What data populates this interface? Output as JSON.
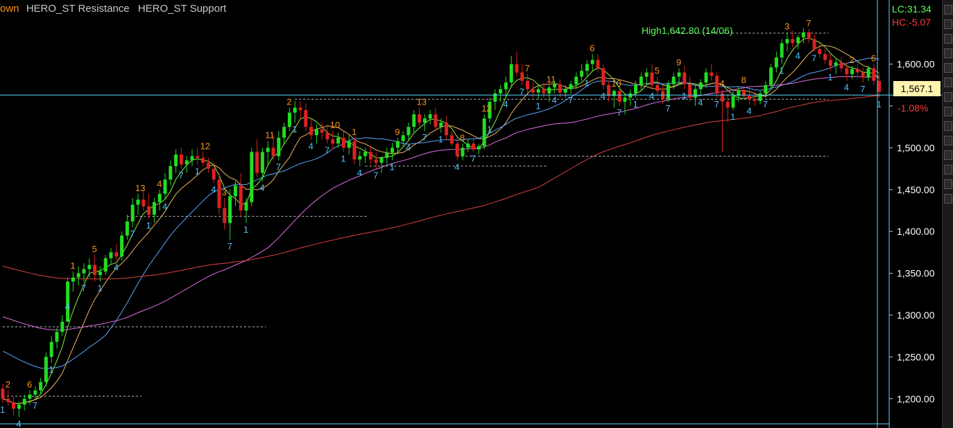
{
  "legend": {
    "cut_item": "own",
    "items": [
      "HERO_ST Resistance",
      "HERO_ST Support"
    ]
  },
  "hud": {
    "lc": "LC:31.34",
    "hc": "HC:-5.07",
    "change": "-1.08%",
    "current_price": "1,567.1"
  },
  "colors": {
    "background": "#000000",
    "up": "#22dd22",
    "down": "#dd2222",
    "cyan_line": "#5ad8ff",
    "ma_green": "#90ee40",
    "ma_orange": "#f0b860",
    "ma_blue": "#5aa8ff",
    "ma_pink": "#e070e0",
    "ma_red": "#e04040",
    "count_blue": "#4fc3f7",
    "count_orange": "#f7941d",
    "axis_text": "#ffffff"
  },
  "toolbar_icons": [
    "ruler-icon",
    "line-icon",
    "text-icon",
    "fib-icon",
    "shape-icon",
    "brush-icon",
    "measure-icon",
    "zoom-icon",
    "magnet-icon",
    "lock-icon",
    "eye-icon",
    "trash-icon",
    "settings-icon",
    "close-icon"
  ],
  "chart_data": {
    "type": "candlestick",
    "y_axis": {
      "range": [
        1170,
        1670
      ],
      "ticks": [
        1200,
        1250,
        1300,
        1350,
        1400,
        1450,
        1500,
        1550,
        1600
      ],
      "tick_labels": [
        "1,200.00",
        "1,250.00",
        "1,300.00",
        "1,350.00",
        "1,400.00",
        "1,450.00",
        "1,500.00",
        "",
        "1,600.00"
      ],
      "position": "right"
    },
    "high_annotation": "High1,642.80 (14/06)",
    "horizontal_line": 1563,
    "candles": [
      [
        1212,
        1218,
        1195,
        1200
      ],
      [
        1200,
        1210,
        1192,
        1196
      ],
      [
        1196,
        1202,
        1180,
        1188
      ],
      [
        1188,
        1197,
        1178,
        1193
      ],
      [
        1193,
        1205,
        1186,
        1200
      ],
      [
        1200,
        1210,
        1193,
        1205
      ],
      [
        1205,
        1215,
        1200,
        1210
      ],
      [
        1210,
        1225,
        1205,
        1220
      ],
      [
        1220,
        1255,
        1215,
        1250
      ],
      [
        1250,
        1275,
        1243,
        1268
      ],
      [
        1268,
        1285,
        1260,
        1280
      ],
      [
        1280,
        1300,
        1275,
        1292
      ],
      [
        1292,
        1345,
        1318,
        1340
      ],
      [
        1340,
        1352,
        1328,
        1345
      ],
      [
        1345,
        1358,
        1335,
        1350
      ],
      [
        1350,
        1362,
        1340,
        1355
      ],
      [
        1355,
        1368,
        1345,
        1360
      ],
      [
        1360,
        1372,
        1340,
        1348
      ],
      [
        1348,
        1358,
        1340,
        1352
      ],
      [
        1352,
        1372,
        1348,
        1368
      ],
      [
        1368,
        1380,
        1360,
        1375
      ],
      [
        1375,
        1385,
        1365,
        1370
      ],
      [
        1370,
        1400,
        1365,
        1395
      ],
      [
        1395,
        1420,
        1390,
        1412
      ],
      [
        1412,
        1440,
        1405,
        1432
      ],
      [
        1432,
        1445,
        1420,
        1438
      ],
      [
        1438,
        1448,
        1425,
        1430
      ],
      [
        1430,
        1445,
        1415,
        1420
      ],
      [
        1420,
        1440,
        1410,
        1435
      ],
      [
        1435,
        1450,
        1425,
        1445
      ],
      [
        1445,
        1470,
        1438,
        1462
      ],
      [
        1462,
        1485,
        1455,
        1478
      ],
      [
        1478,
        1498,
        1470,
        1492
      ],
      [
        1492,
        1500,
        1475,
        1480
      ],
      [
        1480,
        1490,
        1470,
        1485
      ],
      [
        1485,
        1498,
        1478,
        1490
      ],
      [
        1490,
        1500,
        1480,
        1488
      ],
      [
        1488,
        1495,
        1478,
        1482
      ],
      [
        1482,
        1488,
        1470,
        1475
      ],
      [
        1475,
        1482,
        1458,
        1462
      ],
      [
        1462,
        1470,
        1420,
        1428
      ],
      [
        1428,
        1440,
        1402,
        1410
      ],
      [
        1410,
        1450,
        1390,
        1442
      ],
      [
        1442,
        1460,
        1430,
        1455
      ],
      [
        1455,
        1470,
        1418,
        1425
      ],
      [
        1425,
        1440,
        1410,
        1435
      ],
      [
        1435,
        1500,
        1430,
        1495
      ],
      [
        1495,
        1510,
        1465,
        1470
      ],
      [
        1470,
        1500,
        1460,
        1495
      ],
      [
        1495,
        1508,
        1480,
        1500
      ],
      [
        1500,
        1515,
        1485,
        1490
      ],
      [
        1490,
        1520,
        1485,
        1512
      ],
      [
        1512,
        1530,
        1505,
        1525
      ],
      [
        1525,
        1548,
        1520,
        1542
      ],
      [
        1542,
        1556,
        1530,
        1548
      ],
      [
        1548,
        1555,
        1535,
        1545
      ],
      [
        1545,
        1553,
        1520,
        1525
      ],
      [
        1525,
        1535,
        1510,
        1515
      ],
      [
        1515,
        1528,
        1505,
        1522
      ],
      [
        1522,
        1530,
        1510,
        1518
      ],
      [
        1518,
        1528,
        1505,
        1510
      ],
      [
        1510,
        1520,
        1498,
        1505
      ],
      [
        1505,
        1518,
        1500,
        1512
      ],
      [
        1512,
        1520,
        1495,
        1500
      ],
      [
        1500,
        1515,
        1492,
        1508
      ],
      [
        1508,
        1512,
        1480,
        1486
      ],
      [
        1486,
        1496,
        1478,
        1490
      ],
      [
        1490,
        1500,
        1482,
        1495
      ],
      [
        1495,
        1502,
        1480,
        1486
      ],
      [
        1486,
        1494,
        1475,
        1482
      ],
      [
        1482,
        1490,
        1470,
        1488
      ],
      [
        1488,
        1500,
        1480,
        1494
      ],
      [
        1494,
        1506,
        1485,
        1500
      ],
      [
        1500,
        1512,
        1492,
        1508
      ],
      [
        1508,
        1520,
        1500,
        1515
      ],
      [
        1515,
        1530,
        1508,
        1525
      ],
      [
        1525,
        1545,
        1518,
        1540
      ],
      [
        1540,
        1548,
        1525,
        1530
      ],
      [
        1530,
        1540,
        1520,
        1535
      ],
      [
        1535,
        1545,
        1528,
        1540
      ],
      [
        1540,
        1548,
        1520,
        1525
      ],
      [
        1525,
        1535,
        1518,
        1530
      ],
      [
        1530,
        1538,
        1510,
        1515
      ],
      [
        1515,
        1520,
        1502,
        1505
      ],
      [
        1505,
        1512,
        1485,
        1490
      ],
      [
        1490,
        1505,
        1485,
        1500
      ],
      [
        1500,
        1510,
        1495,
        1505
      ],
      [
        1505,
        1512,
        1495,
        1498
      ],
      [
        1498,
        1505,
        1492,
        1502
      ],
      [
        1502,
        1540,
        1498,
        1535
      ],
      [
        1535,
        1560,
        1530,
        1555
      ],
      [
        1555,
        1570,
        1545,
        1565
      ],
      [
        1565,
        1575,
        1555,
        1570
      ],
      [
        1570,
        1585,
        1560,
        1578
      ],
      [
        1578,
        1610,
        1572,
        1600
      ],
      [
        1600,
        1615,
        1585,
        1590
      ],
      [
        1590,
        1600,
        1575,
        1580
      ],
      [
        1580,
        1588,
        1565,
        1570
      ],
      [
        1570,
        1578,
        1560,
        1566
      ],
      [
        1566,
        1575,
        1558,
        1570
      ],
      [
        1570,
        1578,
        1560,
        1565
      ],
      [
        1565,
        1575,
        1555,
        1572
      ],
      [
        1572,
        1580,
        1565,
        1576
      ],
      [
        1576,
        1582,
        1560,
        1566
      ],
      [
        1566,
        1575,
        1560,
        1570
      ],
      [
        1570,
        1580,
        1565,
        1576
      ],
      [
        1576,
        1590,
        1570,
        1585
      ],
      [
        1585,
        1600,
        1580,
        1592
      ],
      [
        1592,
        1605,
        1585,
        1600
      ],
      [
        1600,
        1612,
        1592,
        1605
      ],
      [
        1605,
        1612,
        1590,
        1595
      ],
      [
        1595,
        1600,
        1570,
        1575
      ],
      [
        1575,
        1580,
        1555,
        1562
      ],
      [
        1562,
        1570,
        1548,
        1568
      ],
      [
        1568,
        1575,
        1550,
        1555
      ],
      [
        1555,
        1565,
        1540,
        1560
      ],
      [
        1560,
        1570,
        1550,
        1565
      ],
      [
        1565,
        1580,
        1560,
        1575
      ],
      [
        1575,
        1590,
        1568,
        1585
      ],
      [
        1585,
        1595,
        1575,
        1590
      ],
      [
        1590,
        1600,
        1570,
        1575
      ],
      [
        1575,
        1585,
        1562,
        1568
      ],
      [
        1568,
        1575,
        1552,
        1558
      ],
      [
        1558,
        1580,
        1555,
        1576
      ],
      [
        1576,
        1590,
        1570,
        1585
      ],
      [
        1585,
        1595,
        1575,
        1590
      ],
      [
        1590,
        1598,
        1570,
        1576
      ],
      [
        1576,
        1585,
        1555,
        1560
      ],
      [
        1560,
        1575,
        1550,
        1570
      ],
      [
        1570,
        1582,
        1562,
        1578
      ],
      [
        1578,
        1595,
        1572,
        1590
      ],
      [
        1590,
        1600,
        1580,
        1586
      ],
      [
        1586,
        1590,
        1560,
        1565
      ],
      [
        1565,
        1570,
        1495,
        1555
      ],
      [
        1555,
        1565,
        1530,
        1548
      ],
      [
        1548,
        1568,
        1545,
        1562
      ],
      [
        1562,
        1572,
        1555,
        1568
      ],
      [
        1568,
        1574,
        1558,
        1562
      ],
      [
        1562,
        1570,
        1552,
        1558
      ],
      [
        1558,
        1565,
        1550,
        1556
      ],
      [
        1556,
        1568,
        1552,
        1565
      ],
      [
        1565,
        1580,
        1560,
        1575
      ],
      [
        1575,
        1600,
        1570,
        1596
      ],
      [
        1596,
        1615,
        1590,
        1608
      ],
      [
        1608,
        1630,
        1600,
        1625
      ],
      [
        1625,
        1638,
        1615,
        1630
      ],
      [
        1630,
        1640,
        1620,
        1625
      ],
      [
        1625,
        1635,
        1618,
        1632
      ],
      [
        1632,
        1643,
        1625,
        1638
      ],
      [
        1638,
        1642,
        1625,
        1630
      ],
      [
        1630,
        1636,
        1615,
        1618
      ],
      [
        1618,
        1625,
        1608,
        1612
      ],
      [
        1612,
        1618,
        1600,
        1605
      ],
      [
        1605,
        1612,
        1592,
        1598
      ],
      [
        1598,
        1606,
        1588,
        1602
      ],
      [
        1602,
        1608,
        1590,
        1595
      ],
      [
        1595,
        1602,
        1580,
        1588
      ],
      [
        1588,
        1598,
        1582,
        1594
      ],
      [
        1594,
        1602,
        1585,
        1590
      ],
      [
        1590,
        1596,
        1578,
        1584
      ],
      [
        1584,
        1598,
        1580,
        1595
      ],
      [
        1595,
        1600,
        1575,
        1580
      ],
      [
        1580,
        1588,
        1560,
        1567
      ]
    ],
    "support_resistance_levels": [
      {
        "price": 1637,
        "from": 124,
        "to": 152
      },
      {
        "price": 1558,
        "from": 54,
        "to": 152
      },
      {
        "price": 1490,
        "from": 84,
        "to": 152
      },
      {
        "price": 1418,
        "from": 23,
        "to": 67
      },
      {
        "price": 1478,
        "from": 67,
        "to": 100
      },
      {
        "price": 1286,
        "from": 0,
        "to": 48
      },
      {
        "price": 1203,
        "from": 0,
        "to": 25
      }
    ]
  }
}
